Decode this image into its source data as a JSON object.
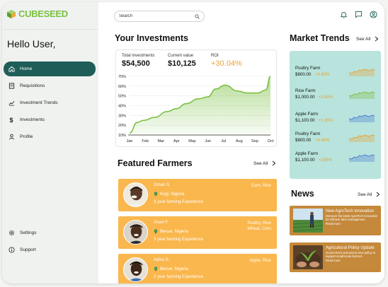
{
  "app": {
    "name": "CUBESEED",
    "colors": {
      "brand": "#7bc043",
      "nav_active": "#1f5e58",
      "farmer_card": "#f9b74d",
      "market_panel": "#b8e4dd",
      "news_card": "#c5893b",
      "positive": "#e7a33a"
    }
  },
  "sidebar": {
    "greeting": "Hello User,",
    "items": [
      {
        "label": "Home",
        "icon": "home-icon",
        "active": true
      },
      {
        "label": "Requisitions",
        "icon": "requisitions-icon",
        "active": false
      },
      {
        "label": "Investment Trends",
        "icon": "trend-chart-icon",
        "active": false
      },
      {
        "label": "Investments",
        "icon": "dollar-icon",
        "active": false
      },
      {
        "label": "Profile",
        "icon": "user-icon",
        "active": false
      }
    ],
    "bottom_items": [
      {
        "label": "Settings",
        "icon": "gear-icon"
      },
      {
        "label": "Support",
        "icon": "info-icon"
      }
    ]
  },
  "header": {
    "search_placeholder": "Search",
    "icons": [
      "bell-icon",
      "chat-icon",
      "account-icon"
    ]
  },
  "investments": {
    "title": "Your Investments",
    "total_label": "Total investments",
    "total_value": "$54,500",
    "current_label": "Current  value",
    "current_value": "$10,125",
    "roi_label": "ROI",
    "roi_value": "+30.04%"
  },
  "chart_data": {
    "type": "area",
    "x": [
      "Jan",
      "Feb",
      "Mar",
      "Apr",
      "May",
      "Jun",
      "Jul",
      "Aug",
      "Sep",
      "Oct"
    ],
    "y_ticks": [
      "10%",
      "20%",
      "30%",
      "40%",
      "50%",
      "60%",
      "70%"
    ],
    "ylim": [
      10,
      70
    ],
    "values": [
      12,
      23,
      25,
      28,
      34,
      37,
      42,
      47,
      49,
      57,
      61,
      55,
      53,
      53,
      56,
      70
    ],
    "x_positions": [
      0,
      0.5,
      0.9,
      1.6,
      2.4,
      3.0,
      3.6,
      4.4,
      5.0,
      5.5,
      6.1,
      6.9,
      7.5,
      8.2,
      8.7,
      9.0
    ],
    "grid": true,
    "color": "#7bc043"
  },
  "farmers": {
    "title": "Featured Farmers",
    "see_all": "See All",
    "items": [
      {
        "name": "Omari S.",
        "location": "Kogi, Nigeria",
        "experience": "3 year farming Experience",
        "crops": [
          "Corn, Rice"
        ]
      },
      {
        "name": "Imani F.",
        "location": "Benue, Nigeria",
        "experience": "3 year farming Experience",
        "crops": [
          "Poultry, Rice",
          "Wheat, Corn"
        ]
      },
      {
        "name": "Adisa S.",
        "location": "Benue, Nigeria",
        "experience": "2 year farming Experience",
        "crops": [
          "Apple, Rice"
        ]
      }
    ]
  },
  "market": {
    "title": "Market Trends",
    "see_all": "See All",
    "items": [
      {
        "name": "Poultry Farm",
        "price": "$800.00",
        "change": "+4.45%",
        "spark_color": "#e7a33a"
      },
      {
        "name": "Rice Farm",
        "price": "$1,000.00",
        "change": "+2.65%",
        "spark_color": "#7bc043"
      },
      {
        "name": "Apple Farm",
        "price": "$1,100.00",
        "change": "+1.85%",
        "spark_color": "#4a7fd1"
      },
      {
        "name": "Poultry Farm",
        "price": "$800.00",
        "change": "+4.45%",
        "spark_color": "#e7a33a"
      },
      {
        "name": "Apple Farm",
        "price": "$1,100.00",
        "change": "+185%",
        "spark_color": "#4a7fd1"
      }
    ]
  },
  "news": {
    "title": "News",
    "see_all": "See All",
    "items": [
      {
        "title": "New AgroTech Innovation",
        "desc": "Discover the latest AgroTech innovation for efficient farm management",
        "read_more": "Read more"
      },
      {
        "title": "Agricultural Policy Update",
        "desc": "Government announces new policy to support small-scale farmers",
        "read_more": "Read more"
      }
    ]
  }
}
